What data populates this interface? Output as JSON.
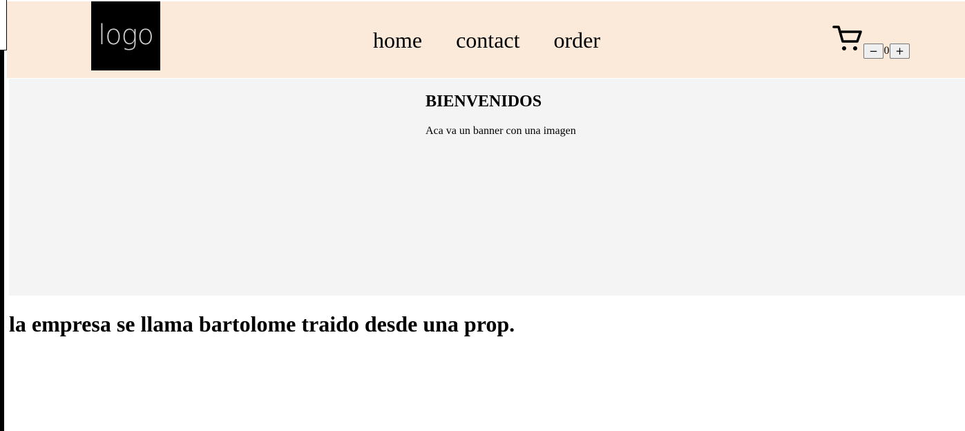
{
  "header": {
    "logo_text": "logo",
    "background": "#fbeada",
    "nav": [
      {
        "label": "home"
      },
      {
        "label": "contact"
      },
      {
        "label": "order"
      }
    ]
  },
  "cart": {
    "icon": "cart-icon",
    "decrement_label": "−",
    "count": "0",
    "increment_label": "+"
  },
  "banner": {
    "title": "BIENVENIDOS",
    "text": "Aca va un banner con una imagen",
    "background": "#f4f4f4"
  },
  "main": {
    "company_text": "la empresa se llama bartolome traido desde una prop."
  }
}
